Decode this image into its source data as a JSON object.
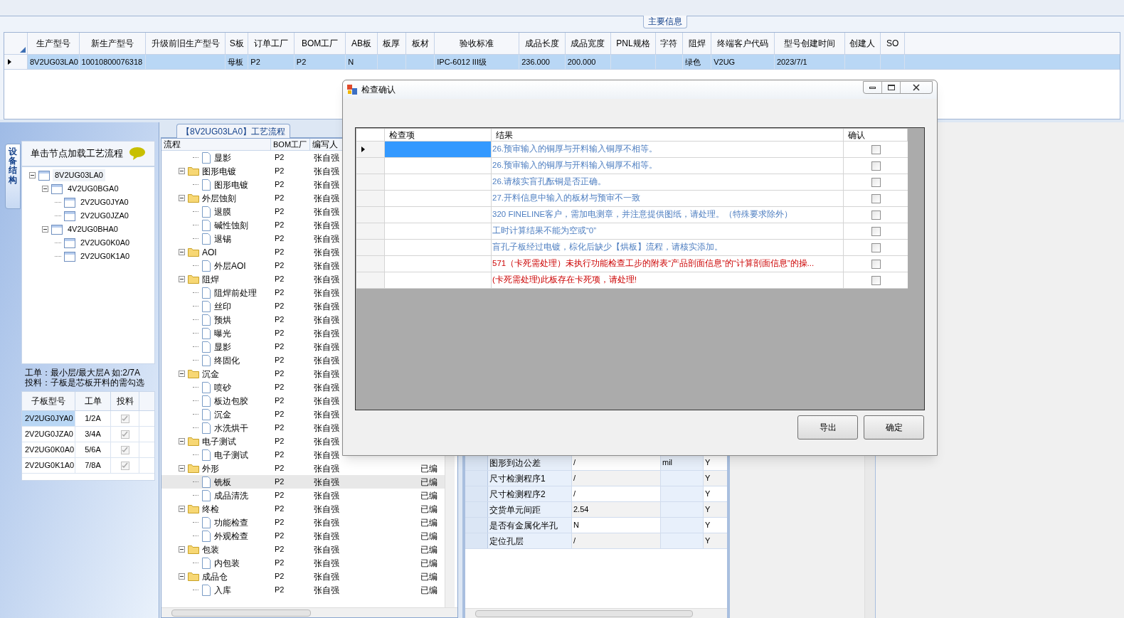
{
  "main_info": {
    "title": "主要信息",
    "columns": [
      "生产型号",
      "新生产型号",
      "升级前旧生产型号",
      "S板",
      "订单工厂",
      "BOM工厂",
      "AB板",
      "板厚",
      "板材",
      "验收标准",
      "成品长度",
      "成品宽度",
      "PNL规格",
      "字符",
      "阻焊",
      "终端客户代码",
      "型号创建时间",
      "创建人",
      "SO"
    ],
    "rows": [
      {
        "selected": true,
        "cells": [
          "8V2UG03LA0",
          "10010800076318",
          null,
          "母板",
          "P2",
          "P2",
          "N",
          null,
          null,
          "IPC-6012 III级",
          "236.000",
          "200.000",
          null,
          null,
          "绿色",
          "V2UG",
          "2023/7/1",
          null,
          null
        ]
      }
    ]
  },
  "left_panel": {
    "side_tab": "设备结构",
    "header": "单击节点加载工艺流程",
    "tree": [
      {
        "label": "8V2UG03LA0",
        "expanded": true,
        "children": [
          {
            "label": "4V2UG0BGA0",
            "expanded": true,
            "children": [
              {
                "label": "2V2UG0JYA0"
              },
              {
                "label": "2V2UG0JZA0"
              }
            ]
          },
          {
            "label": "4V2UG0BHA0",
            "expanded": true,
            "children": [
              {
                "label": "2V2UG0K0A0"
              },
              {
                "label": "2V2UG0K1A0"
              }
            ]
          }
        ]
      }
    ],
    "notes": [
      "工单：最小层/最大层A 如:2/7A",
      "投料：子板是芯板开料的需勾选"
    ],
    "sub_grid": {
      "columns": [
        "子板型号",
        "工单",
        "投料"
      ],
      "rows": [
        {
          "board": "2V2UG0JYA0",
          "order": "1/2A",
          "feed": true,
          "selected": true
        },
        {
          "board": "2V2UG0JZA0",
          "order": "3/4A",
          "feed": true,
          "selected": false
        },
        {
          "board": "2V2UG0K0A0",
          "order": "5/6A",
          "feed": true,
          "selected": false
        },
        {
          "board": "2V2UG0K1A0",
          "order": "7/8A",
          "feed": true,
          "selected": false
        }
      ]
    }
  },
  "process": {
    "title": "【8V2UG03LA0】工艺流程",
    "columns": [
      "流程",
      "BOM工厂",
      "编写人"
    ],
    "rows": [
      {
        "kind": "doc",
        "name": "显影",
        "bom": "P2",
        "author": "张自强",
        "selected": false
      },
      {
        "kind": "folder",
        "name": "图形电镀",
        "bom": "P2",
        "author": "张自强",
        "expanded": true,
        "selected": false,
        "children": [
          {
            "kind": "doc",
            "name": "图形电镀",
            "bom": "P2",
            "author": "张自强",
            "selected": false
          }
        ]
      },
      {
        "kind": "folder",
        "name": "外层蚀刻",
        "bom": "P2",
        "author": "张自强",
        "expanded": true,
        "selected": false,
        "children": [
          {
            "kind": "doc",
            "name": "退膜",
            "bom": "P2",
            "author": "张自强",
            "selected": false
          },
          {
            "kind": "doc",
            "name": "碱性蚀刻",
            "bom": "P2",
            "author": "张自强",
            "selected": false
          },
          {
            "kind": "doc",
            "name": "退锡",
            "bom": "P2",
            "author": "张自强",
            "selected": false
          }
        ]
      },
      {
        "kind": "folder",
        "name": "AOI",
        "bom": "P2",
        "author": "张自强",
        "expanded": true,
        "selected": false,
        "children": [
          {
            "kind": "doc",
            "name": "外层AOI",
            "bom": "P2",
            "author": "张自强",
            "selected": false
          }
        ]
      },
      {
        "kind": "folder",
        "name": "阻焊",
        "bom": "P2",
        "author": "张自强",
        "expanded": true,
        "selected": false,
        "children": [
          {
            "kind": "doc",
            "name": "阻焊前处理",
            "bom": "P2",
            "author": "张自强",
            "selected": false
          },
          {
            "kind": "doc",
            "name": "丝印",
            "bom": "P2",
            "author": "张自强",
            "selected": false
          },
          {
            "kind": "doc",
            "name": "预烘",
            "bom": "P2",
            "author": "张自强",
            "selected": false
          },
          {
            "kind": "doc",
            "name": "曝光",
            "bom": "P2",
            "author": "张自强",
            "selected": false
          },
          {
            "kind": "doc",
            "name": "显影",
            "bom": "P2",
            "author": "张自强",
            "selected": false
          },
          {
            "kind": "doc",
            "name": "终固化",
            "bom": "P2",
            "author": "张自强",
            "selected": false
          }
        ]
      },
      {
        "kind": "folder",
        "name": "沉金",
        "bom": "P2",
        "author": "张自强",
        "expanded": true,
        "selected": false,
        "children": [
          {
            "kind": "doc",
            "name": "喷砂",
            "bom": "P2",
            "author": "张自强",
            "selected": false
          },
          {
            "kind": "doc",
            "name": "板边包胶",
            "bom": "P2",
            "author": "张自强",
            "selected": false
          },
          {
            "kind": "doc",
            "name": "沉金",
            "bom": "P2",
            "author": "张自强",
            "selected": false
          },
          {
            "kind": "doc",
            "name": "水洗烘干",
            "bom": "P2",
            "author": "张自强",
            "selected": false
          }
        ]
      },
      {
        "kind": "folder",
        "name": "电子测试",
        "bom": "P2",
        "author": "张自强",
        "expanded": true,
        "selected": false,
        "children": [
          {
            "kind": "doc",
            "name": "电子测试",
            "bom": "P2",
            "author": "张自强",
            "selected": false
          }
        ]
      },
      {
        "kind": "folder",
        "name": "外形",
        "bom": "P2",
        "author": "张自强",
        "status": "已编",
        "expanded": true,
        "selected": false,
        "children": [
          {
            "kind": "doc",
            "name": "铣板",
            "bom": "P2",
            "author": "张自强",
            "status": "已编",
            "selected": true
          },
          {
            "kind": "doc",
            "name": "成品清洗",
            "bom": "P2",
            "author": "张自强",
            "status": "已编",
            "selected": false
          }
        ]
      },
      {
        "kind": "folder",
        "name": "终检",
        "bom": "P2",
        "author": "张自强",
        "status": "已编",
        "expanded": true,
        "selected": false,
        "children": [
          {
            "kind": "doc",
            "name": "功能检查",
            "bom": "P2",
            "author": "张自强",
            "status": "已编",
            "selected": false
          },
          {
            "kind": "doc",
            "name": "外观检查",
            "bom": "P2",
            "author": "张自强",
            "status": "已编",
            "selected": false
          }
        ]
      },
      {
        "kind": "folder",
        "name": "包装",
        "bom": "P2",
        "author": "张自强",
        "status": "已编",
        "expanded": true,
        "selected": false,
        "children": [
          {
            "kind": "doc",
            "name": "内包装",
            "bom": "P2",
            "author": "张自强",
            "status": "已编",
            "selected": false
          }
        ]
      },
      {
        "kind": "folder",
        "name": "成品仓",
        "bom": "P2",
        "author": "张自强",
        "status": "已编",
        "expanded": true,
        "selected": false,
        "children": [
          {
            "kind": "doc",
            "name": "入库",
            "bom": "P2",
            "author": "张自强",
            "status": "已编",
            "selected": false
          }
        ]
      }
    ]
  },
  "params": {
    "rows": [
      {
        "name": "图形到边公差",
        "value": "/",
        "unit": "mil",
        "flag": "Y"
      },
      {
        "name": "尺寸检测程序1",
        "value": "/",
        "flag": "Y"
      },
      {
        "name": "尺寸检测程序2",
        "value": "/",
        "flag": "Y"
      },
      {
        "name": "交货单元间距",
        "value": "2.54",
        "flag": "Y"
      },
      {
        "name": "是否有金属化半孔",
        "value": "N",
        "flag": "Y"
      },
      {
        "name": "定位孔层",
        "value": "/",
        "flag": "Y"
      }
    ]
  },
  "dialog": {
    "title": "检查确认",
    "columns": [
      "检查项",
      "结果",
      "确认"
    ],
    "rows": [
      {
        "result": "26.预审输入的铜厚与开料输入铜厚不相等。",
        "color": "#4f7fc1",
        "checked": false,
        "selected": true
      },
      {
        "result": "26.预审输入的铜厚与开料输入铜厚不相等。",
        "color": "#4f7fc1",
        "checked": false,
        "selected": false
      },
      {
        "result": "26.请核实盲孔酝铜是否正确。",
        "color": "#4f7fc1",
        "checked": false,
        "selected": false
      },
      {
        "result": "27.开料信息中输入的板材与预审不一致",
        "color": "#4f7fc1",
        "checked": false,
        "selected": false
      },
      {
        "result": "320 FINELINE客户，需加电测章，并注意提供图纸，请处理。（特殊要求除外）",
        "color": "#4f7fc1",
        "checked": false,
        "selected": false
      },
      {
        "result": "工时计算结果不能为空或“0”",
        "color": "#4f7fc1",
        "checked": false,
        "selected": false
      },
      {
        "result": "盲孔子板经过电镀，棕化后缺少【烘板】流程，请核实添加。",
        "color": "#4f7fc1",
        "checked": false,
        "selected": false
      },
      {
        "result": "571（卡死需处理）未执行功能检查工步的附表“产品剖面信息”的“计算剖面信息”的操...",
        "color": "#cc0000",
        "checked": false,
        "selected": false
      },
      {
        "result": "(卡死需处理)此板存在卡死项，请处理!",
        "color": "#cc0000",
        "checked": false,
        "selected": false
      }
    ],
    "buttons": [
      "导出",
      "确定"
    ]
  }
}
